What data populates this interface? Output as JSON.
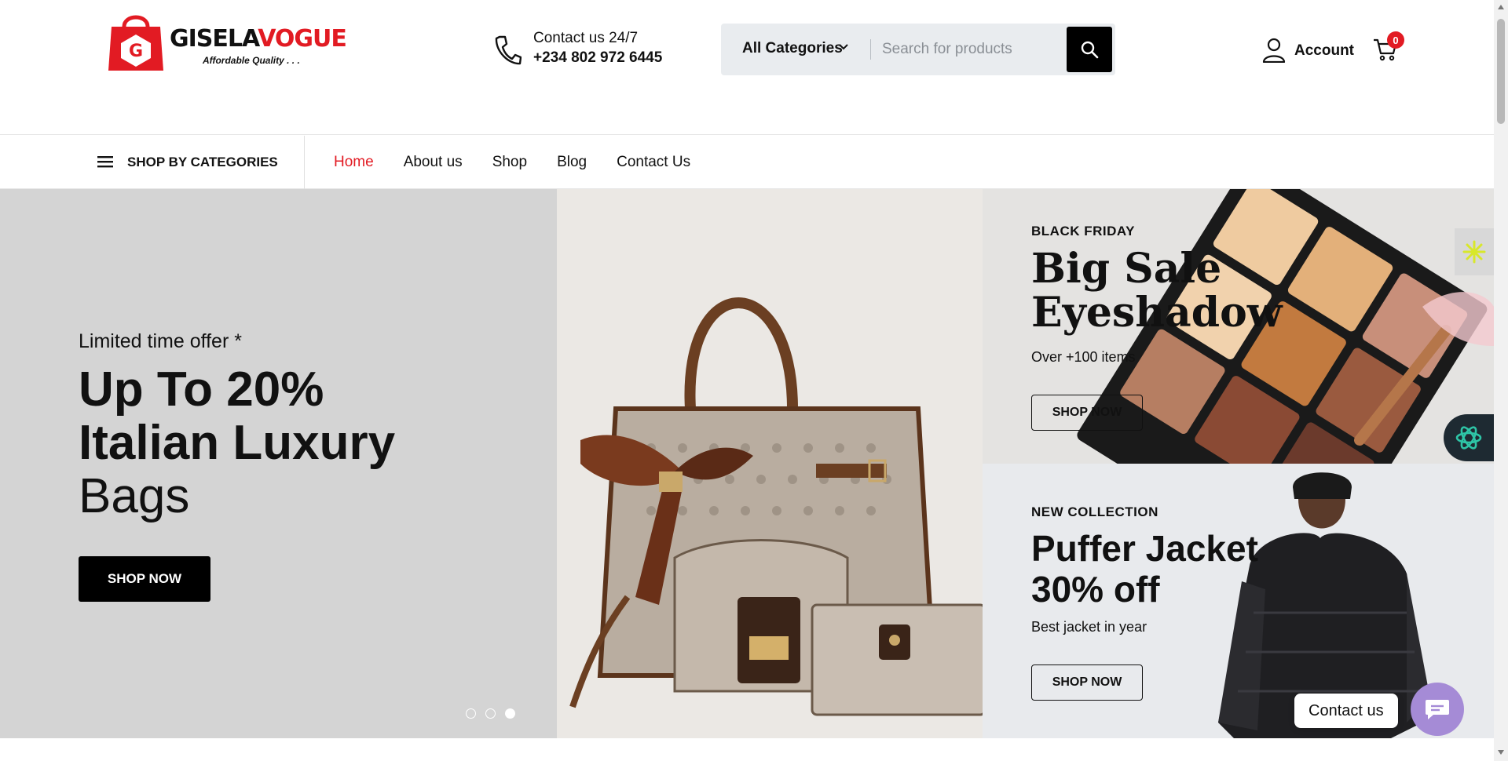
{
  "brand": {
    "name_part1": "GISELA",
    "name_part2": "VOGUE",
    "tagline": "Affordable Quality . . .",
    "primary_color": "#e21b23"
  },
  "contact": {
    "line1": "Contact us 24/7",
    "phone": "+234 802 972 6445",
    "icon": "phone-icon"
  },
  "search": {
    "category_label": "All Categories",
    "placeholder": "Search for products",
    "value": "",
    "button_icon": "search-icon"
  },
  "account": {
    "label": "Account",
    "icon": "user-icon"
  },
  "cart": {
    "count": "0",
    "icon": "cart-icon"
  },
  "nav": {
    "categories_label": "SHOP BY CATEGORIES",
    "links": [
      {
        "label": "Home",
        "active": true
      },
      {
        "label": "About us",
        "active": false
      },
      {
        "label": "Shop",
        "active": false
      },
      {
        "label": "Blog",
        "active": false
      },
      {
        "label": "Contact Us",
        "active": false
      }
    ]
  },
  "hero": {
    "eyebrow": "Limited time offer *",
    "title_line1": "Up To 20%",
    "title_line2": "Italian Luxury",
    "title_line3": "Bags",
    "button": "SHOP NOW",
    "slide_count": 3,
    "active_slide": 3
  },
  "banners": [
    {
      "eyebrow": "BLACK FRIDAY",
      "title_line1": "Big Sale",
      "title_line2": "Eyeshadow",
      "subtitle": "Over +100 items",
      "button": "SHOP NOW"
    },
    {
      "eyebrow": "NEW COLLECTION",
      "title_line1": "Puffer Jacket",
      "title_line2": "30% off",
      "subtitle": "Best jacket in year",
      "button": "SHOP NOW"
    }
  ],
  "widgets": {
    "contact_chip": "Contact us",
    "chat_icon": "chat-icon"
  }
}
